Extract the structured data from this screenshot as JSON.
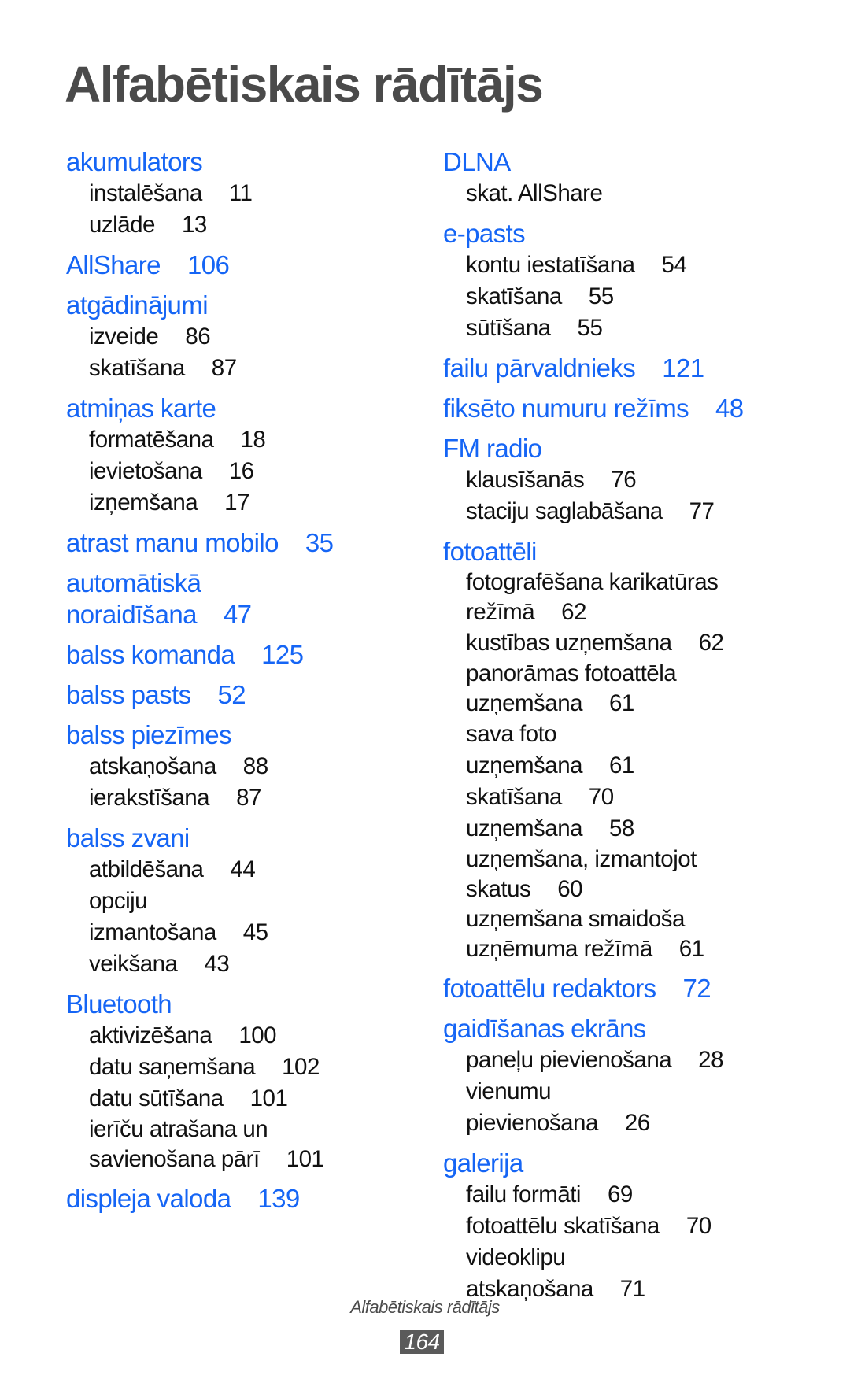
{
  "page": {
    "title": "Alfabētiskais rādītājs",
    "footer_label": "Alfabētiskais rādītājs",
    "page_number": "164"
  },
  "colors": {
    "heading": "#1565f5",
    "subitem": "#111111",
    "title": "#4a4a4a",
    "page_number_bg": "#5a5a5a"
  },
  "columns": [
    {
      "entries": [
        {
          "term": "akumulators",
          "page": "",
          "subs": [
            {
              "text": "instalēšana",
              "page": "11"
            },
            {
              "text": "uzlāde",
              "page": "13"
            }
          ]
        },
        {
          "term": "AllShare",
          "page": "106",
          "subs": []
        },
        {
          "term": "atgādinājumi",
          "page": "",
          "subs": [
            {
              "text": "izveide",
              "page": "86"
            },
            {
              "text": "skatīšana",
              "page": "87"
            }
          ]
        },
        {
          "term": "atmiņas karte",
          "page": "",
          "subs": [
            {
              "text": "formatēšana",
              "page": "18"
            },
            {
              "text": "ievietošana",
              "page": "16"
            },
            {
              "text": "izņemšana",
              "page": "17"
            }
          ]
        },
        {
          "term": "atrast manu mobilo",
          "page": "35",
          "subs": []
        },
        {
          "term": "automātiskā noraidīšana",
          "page": "47",
          "subs": []
        },
        {
          "term": "balss komanda",
          "page": "125",
          "subs": []
        },
        {
          "term": "balss pasts",
          "page": "52",
          "subs": []
        },
        {
          "term": "balss piezīmes",
          "page": "",
          "subs": [
            {
              "text": "atskaņošana",
              "page": "88"
            },
            {
              "text": "ierakstīšana",
              "page": "87"
            }
          ]
        },
        {
          "term": "balss zvani",
          "page": "",
          "subs": [
            {
              "text": "atbildēšana",
              "page": "44"
            },
            {
              "text": "opciju izmantošana",
              "page": "45"
            },
            {
              "text": "veikšana",
              "page": "43"
            }
          ]
        },
        {
          "term": "Bluetooth",
          "page": "",
          "subs": [
            {
              "text": "aktivizēšana",
              "page": "100"
            },
            {
              "text": "datu saņemšana",
              "page": "102"
            },
            {
              "text": "datu sūtīšana",
              "page": "101"
            },
            {
              "text": "ierīču atrašana un savienošana pārī",
              "page": "101"
            }
          ]
        },
        {
          "term": "displeja valoda",
          "page": "139",
          "subs": []
        }
      ]
    },
    {
      "entries": [
        {
          "term": "DLNA",
          "page": "",
          "subs": [
            {
              "text": "skat. AllShare",
              "page": ""
            }
          ]
        },
        {
          "term": "e-pasts",
          "page": "",
          "subs": [
            {
              "text": "kontu iestatīšana",
              "page": "54"
            },
            {
              "text": "skatīšana",
              "page": "55"
            },
            {
              "text": "sūtīšana",
              "page": "55"
            }
          ]
        },
        {
          "term": "failu pārvaldnieks",
          "page": "121",
          "subs": []
        },
        {
          "term": "fiksēto numuru režīms",
          "page": "48",
          "subs": []
        },
        {
          "term": "FM radio",
          "page": "",
          "subs": [
            {
              "text": "klausīšanās",
              "page": "76"
            },
            {
              "text": "staciju saglabāšana",
              "page": "77"
            }
          ]
        },
        {
          "term": "fotoattēli",
          "page": "",
          "subs": [
            {
              "text": "fotografēšana karikatūras režīmā",
              "page": "62"
            },
            {
              "text": "kustības uzņemšana",
              "page": "62"
            },
            {
              "text": "panorāmas fotoattēla uzņemšana",
              "page": "61"
            },
            {
              "text": "sava foto uzņemšana",
              "page": "61"
            },
            {
              "text": "skatīšana",
              "page": "70"
            },
            {
              "text": "uzņemšana",
              "page": "58"
            },
            {
              "text": "uzņemšana, izmantojot skatus",
              "page": "60"
            },
            {
              "text": "uzņemšana smaidoša uzņēmuma režīmā",
              "page": "61"
            }
          ]
        },
        {
          "term": "fotoattēlu redaktors",
          "page": "72",
          "subs": []
        },
        {
          "term": "gaidīšanas ekrāns",
          "page": "",
          "subs": [
            {
              "text": "paneļu pievienošana",
              "page": "28"
            },
            {
              "text": "vienumu pievienošana",
              "page": "26"
            }
          ]
        },
        {
          "term": "galerija",
          "page": "",
          "subs": [
            {
              "text": "failu formāti",
              "page": "69"
            },
            {
              "text": "fotoattēlu skatīšana",
              "page": "70"
            },
            {
              "text": "videoklipu atskaņošana",
              "page": "71"
            }
          ]
        }
      ]
    }
  ]
}
